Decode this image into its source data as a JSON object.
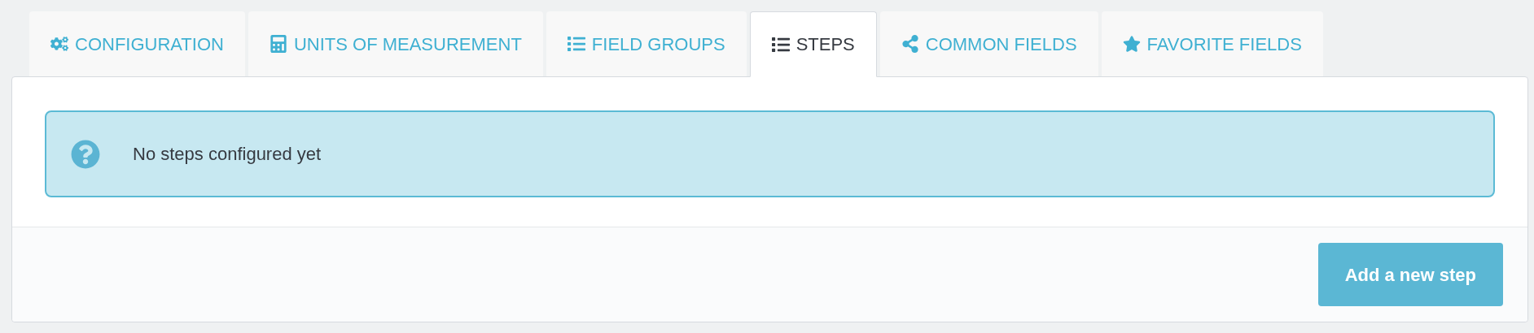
{
  "tabs": [
    {
      "label": "CONFIGURATION",
      "kind": "cogs",
      "selected": false
    },
    {
      "label": "UNITS OF MEASUREMENT",
      "kind": "calculator",
      "selected": false
    },
    {
      "label": "FIELD GROUPS",
      "kind": "list",
      "selected": false
    },
    {
      "label": "STEPS",
      "kind": "list",
      "selected": true
    },
    {
      "label": "COMMON FIELDS",
      "kind": "share",
      "selected": false
    },
    {
      "label": "FAVORITE FIELDS",
      "kind": "star",
      "selected": false
    }
  ],
  "alert": {
    "message": "No steps configured yet"
  },
  "footer": {
    "button": "Add a new step"
  }
}
